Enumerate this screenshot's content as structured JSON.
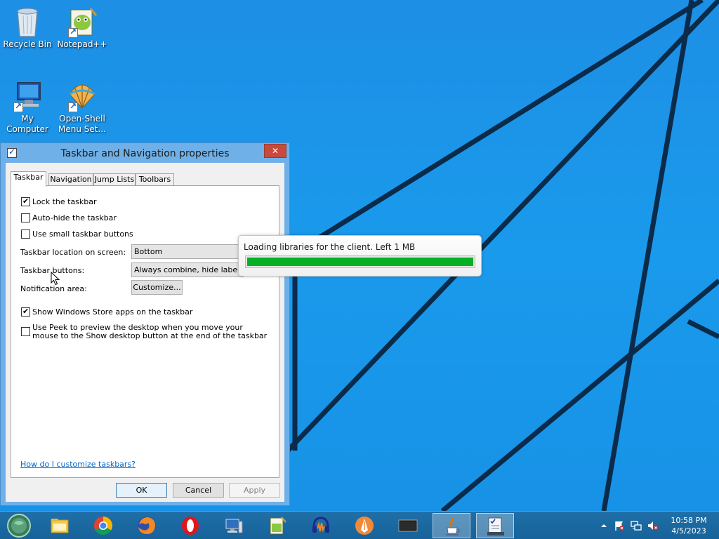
{
  "desktop": {
    "icons": [
      {
        "label": "Recycle Bin",
        "icon": "recycle-bin-icon"
      },
      {
        "label": "Notepad++",
        "icon": "notepad-plus-plus-icon"
      },
      {
        "label": "My Computer",
        "icon": "my-computer-icon"
      },
      {
        "label": "Open-Shell Menu Set...",
        "label_line1": "Open-Shell",
        "label_line2": "Menu Set...",
        "icon": "open-shell-icon"
      }
    ]
  },
  "dialog": {
    "title": "Taskbar and Navigation properties",
    "close_label": "✕",
    "tabs": [
      {
        "label": "Taskbar",
        "active": true
      },
      {
        "label": "Navigation",
        "active": false
      },
      {
        "label": "Jump Lists",
        "active": false
      },
      {
        "label": "Toolbars",
        "active": false
      }
    ],
    "checkboxes": [
      {
        "label": "Lock the taskbar",
        "checked": true
      },
      {
        "label": "Auto-hide the taskbar",
        "checked": false
      },
      {
        "label": "Use small taskbar buttons",
        "checked": false
      },
      {
        "label": "Show Windows Store apps on the taskbar",
        "checked": true
      },
      {
        "label": "Use Peek to preview the desktop when you move your mouse to the Show desktop button at the end of the taskbar",
        "checked": false
      }
    ],
    "location_label": "Taskbar location on screen:",
    "location_value": "Bottom",
    "buttons_label": "Taskbar buttons:",
    "buttons_value": "Always combine, hide labels",
    "notification_label": "Notification area:",
    "customize_label": "Customize...",
    "help_link": "How do I customize taskbars?",
    "ok_label": "OK",
    "cancel_label": "Cancel",
    "apply_label": "Apply"
  },
  "progress_popup": {
    "message": "Loading libraries for the client. Left 1 MB",
    "progress": 1.0,
    "color": "#06b025"
  },
  "taskbar": {
    "start_icon": "start-orb-icon",
    "items": [
      {
        "icon": "file-explorer-icon",
        "active": false
      },
      {
        "icon": "chrome-icon",
        "active": false
      },
      {
        "icon": "firefox-icon",
        "active": false
      },
      {
        "icon": "opera-icon",
        "active": false
      },
      {
        "icon": "network-computer-icon",
        "active": false
      },
      {
        "icon": "notepad-plus-plus-icon",
        "active": false
      },
      {
        "icon": "audacity-icon",
        "active": false
      },
      {
        "icon": "pen-app-icon",
        "active": false
      },
      {
        "icon": "monitor-icon",
        "active": false
      },
      {
        "icon": "java-icon",
        "active": true
      },
      {
        "icon": "taskbar-properties-icon",
        "active": true
      }
    ],
    "tray_icons": [
      "tray-overflow-icon",
      "action-center-flag-icon",
      "network-icon",
      "volume-muted-icon"
    ],
    "time": "10:58 PM",
    "date": "4/5/2023"
  }
}
